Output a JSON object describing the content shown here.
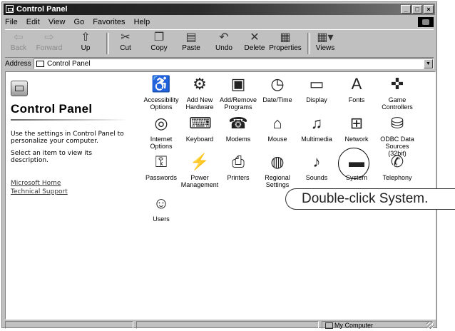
{
  "window": {
    "title": "Control Panel"
  },
  "menu": [
    "File",
    "Edit",
    "View",
    "Go",
    "Favorites",
    "Help"
  ],
  "toolbar": [
    {
      "label": "Back",
      "icon": "back-arrow-icon",
      "enabled": false
    },
    {
      "label": "Forward",
      "icon": "forward-arrow-icon",
      "enabled": false
    },
    {
      "label": "Up",
      "icon": "up-folder-icon",
      "enabled": true
    },
    {
      "label": "Cut",
      "icon": "scissors-icon",
      "enabled": true
    },
    {
      "label": "Copy",
      "icon": "copy-icon",
      "enabled": true
    },
    {
      "label": "Paste",
      "icon": "paste-icon",
      "enabled": true
    },
    {
      "label": "Undo",
      "icon": "undo-icon",
      "enabled": true
    },
    {
      "label": "Delete",
      "icon": "delete-x-icon",
      "enabled": true
    },
    {
      "label": "Properties",
      "icon": "properties-icon",
      "enabled": true
    },
    {
      "label": "Views",
      "icon": "views-icon",
      "enabled": true
    }
  ],
  "address": {
    "label": "Address",
    "value": "Control Panel"
  },
  "leftpane": {
    "title": "Control Panel",
    "desc1": "Use the settings in Control Panel to personalize your computer.",
    "desc2": "Select an item to view its description.",
    "link1": "Microsoft Home",
    "link2": "Technical Support"
  },
  "items": [
    {
      "label": "Accessibility Options",
      "icon": "accessibility-icon"
    },
    {
      "label": "Add New Hardware",
      "icon": "add-hardware-icon"
    },
    {
      "label": "Add/Remove Programs",
      "icon": "add-remove-programs-icon"
    },
    {
      "label": "Date/Time",
      "icon": "date-time-icon"
    },
    {
      "label": "Display",
      "icon": "display-icon"
    },
    {
      "label": "Fonts",
      "icon": "fonts-icon"
    },
    {
      "label": "Game Controllers",
      "icon": "game-controllers-icon"
    },
    {
      "label": "Internet Options",
      "icon": "internet-options-icon"
    },
    {
      "label": "Keyboard",
      "icon": "keyboard-icon"
    },
    {
      "label": "Modems",
      "icon": "modem-icon"
    },
    {
      "label": "Mouse",
      "icon": "mouse-icon"
    },
    {
      "label": "Multimedia",
      "icon": "multimedia-icon"
    },
    {
      "label": "Network",
      "icon": "network-icon"
    },
    {
      "label": "ODBC Data Sources (32bit)",
      "icon": "odbc-icon"
    },
    {
      "label": "Passwords",
      "icon": "passwords-icon"
    },
    {
      "label": "Power Management",
      "icon": "power-management-icon"
    },
    {
      "label": "Printers",
      "icon": "printers-icon"
    },
    {
      "label": "Regional Settings",
      "icon": "regional-settings-icon"
    },
    {
      "label": "Sounds",
      "icon": "sounds-icon"
    },
    {
      "label": "System",
      "icon": "system-icon"
    },
    {
      "label": "Telephony",
      "icon": "telephony-icon"
    },
    {
      "label": "Users",
      "icon": "users-icon"
    }
  ],
  "callout": "Double-click System.",
  "status": {
    "location": "My Computer"
  }
}
